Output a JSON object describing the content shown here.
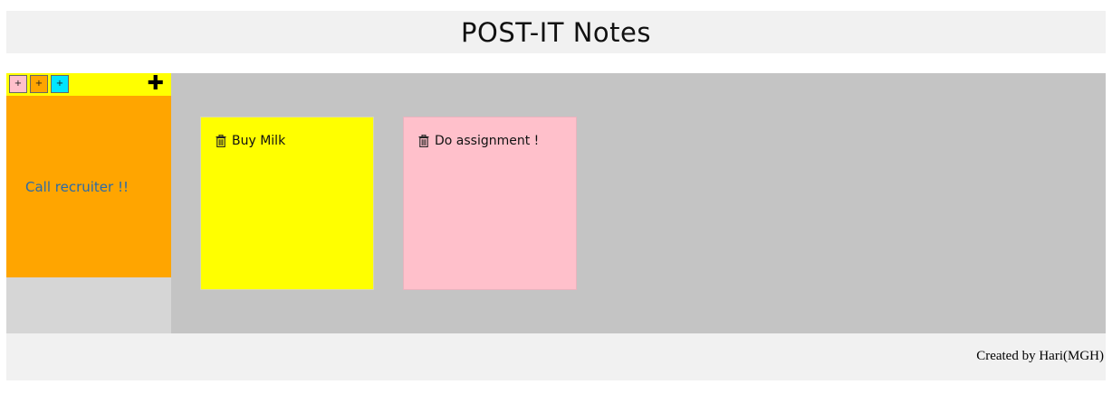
{
  "header": {
    "title": "POST-IT Notes"
  },
  "sidebar": {
    "color_buttons": [
      {
        "label": "+",
        "color": "#ffc0cb"
      },
      {
        "label": "+",
        "color": "#ffa500"
      },
      {
        "label": "+",
        "color": "#00e5ff"
      }
    ],
    "add_label": "✚",
    "toolbar_color": "#ffff00",
    "editor": {
      "text": "Call recruiter !!",
      "color": "#ffa500",
      "text_color": "#2a6aa8"
    }
  },
  "board": {
    "notes": [
      {
        "text": "Buy Milk",
        "color": "#ffff00",
        "icon": "trash-icon"
      },
      {
        "text": "Do assignment !",
        "color": "#ffc0cb",
        "icon": "trash-icon"
      }
    ]
  },
  "footer": {
    "credit": "Created by Hari(MGH)"
  }
}
